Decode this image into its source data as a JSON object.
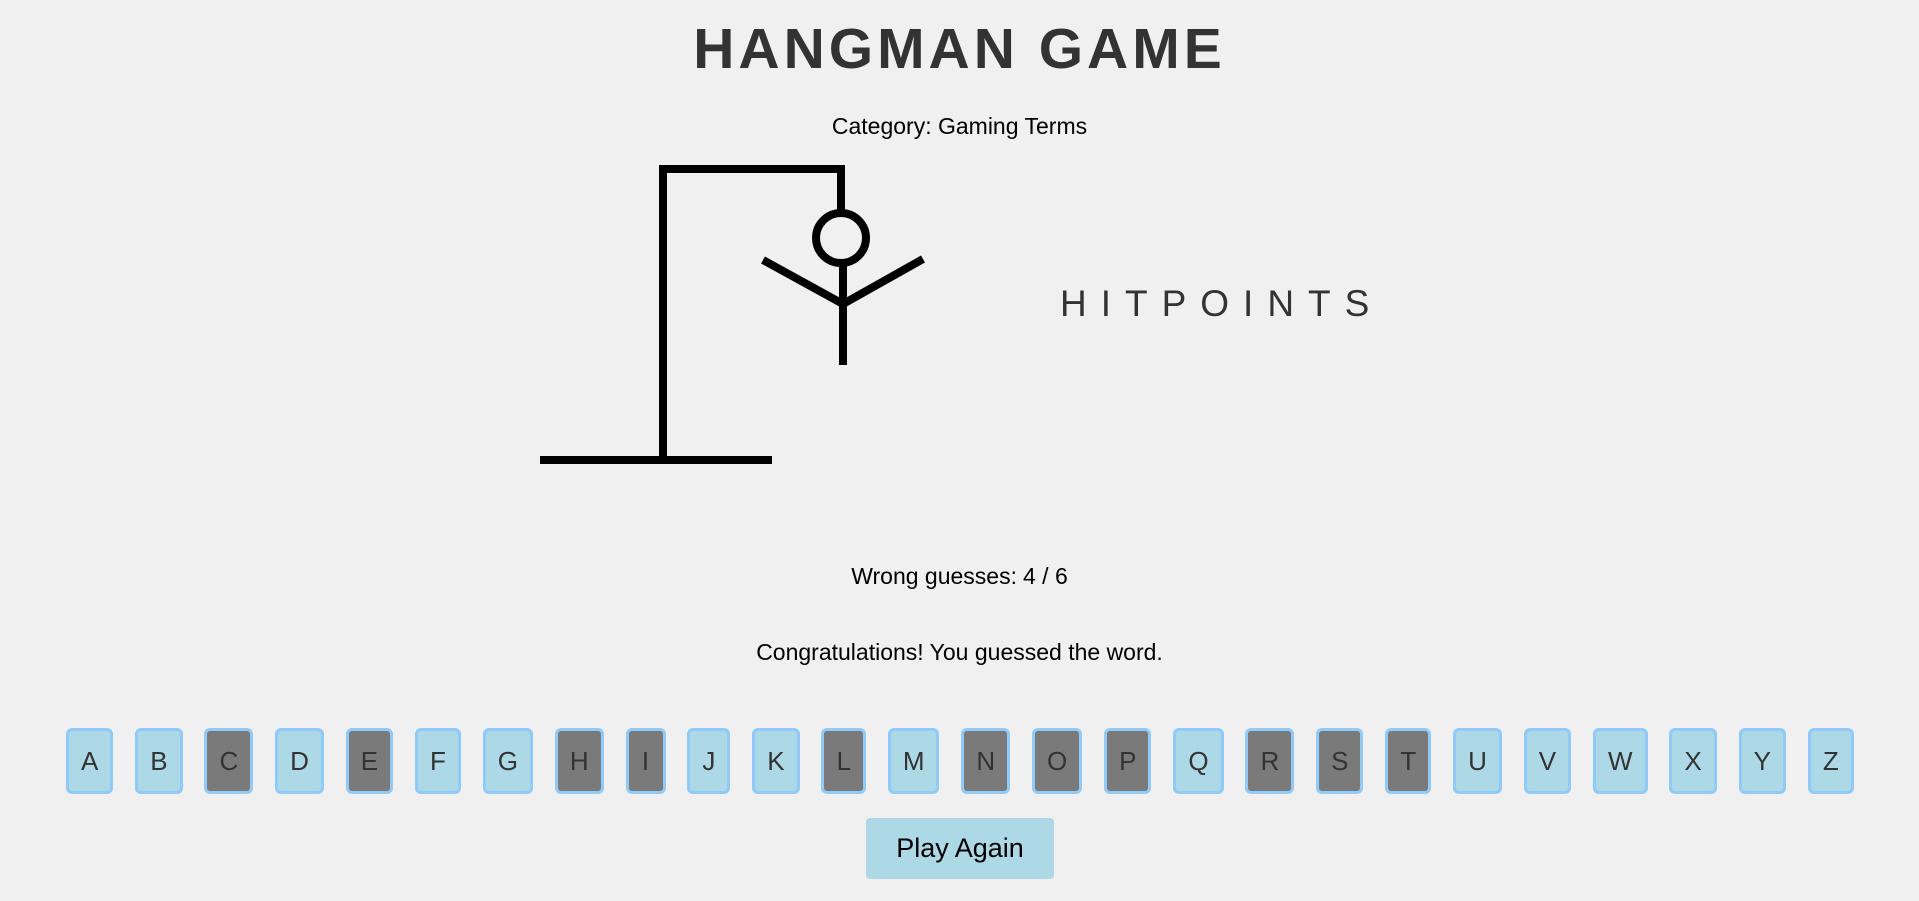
{
  "header": {
    "title": "HANGMAN GAME"
  },
  "category": {
    "label": "Category:",
    "value": "Gaming Terms"
  },
  "word": {
    "display": "HITPOINTS",
    "letters": [
      "H",
      "I",
      "T",
      "P",
      "O",
      "I",
      "N",
      "T",
      "S"
    ]
  },
  "status": {
    "wrong_label": "Wrong guesses:",
    "wrong_count": "4 / 6",
    "wrong_guesses": 4,
    "max_wrong": 6,
    "message": "Congratulations! You guessed the word."
  },
  "hangman": {
    "parts_shown": [
      "head",
      "body",
      "left-arm",
      "right-arm"
    ],
    "stroke_color": "#000000"
  },
  "keyboard": {
    "keys": [
      {
        "letter": "A",
        "used": false
      },
      {
        "letter": "B",
        "used": false
      },
      {
        "letter": "C",
        "used": true
      },
      {
        "letter": "D",
        "used": false
      },
      {
        "letter": "E",
        "used": true
      },
      {
        "letter": "F",
        "used": false
      },
      {
        "letter": "G",
        "used": false
      },
      {
        "letter": "H",
        "used": true
      },
      {
        "letter": "I",
        "used": true
      },
      {
        "letter": "J",
        "used": false
      },
      {
        "letter": "K",
        "used": false
      },
      {
        "letter": "L",
        "used": true
      },
      {
        "letter": "M",
        "used": false
      },
      {
        "letter": "N",
        "used": true
      },
      {
        "letter": "O",
        "used": true
      },
      {
        "letter": "P",
        "used": true
      },
      {
        "letter": "Q",
        "used": false
      },
      {
        "letter": "R",
        "used": true
      },
      {
        "letter": "S",
        "used": true
      },
      {
        "letter": "T",
        "used": true
      },
      {
        "letter": "U",
        "used": false
      },
      {
        "letter": "V",
        "used": false
      },
      {
        "letter": "W",
        "used": false
      },
      {
        "letter": "X",
        "used": false
      },
      {
        "letter": "Y",
        "used": false
      },
      {
        "letter": "Z",
        "used": false
      }
    ]
  },
  "actions": {
    "play_again_label": "Play Again"
  },
  "colors": {
    "background": "#f0f0f0",
    "key_available": "#add8e6",
    "key_used": "#7a7a7a",
    "key_border": "#90caf9",
    "title_text": "#333333"
  }
}
